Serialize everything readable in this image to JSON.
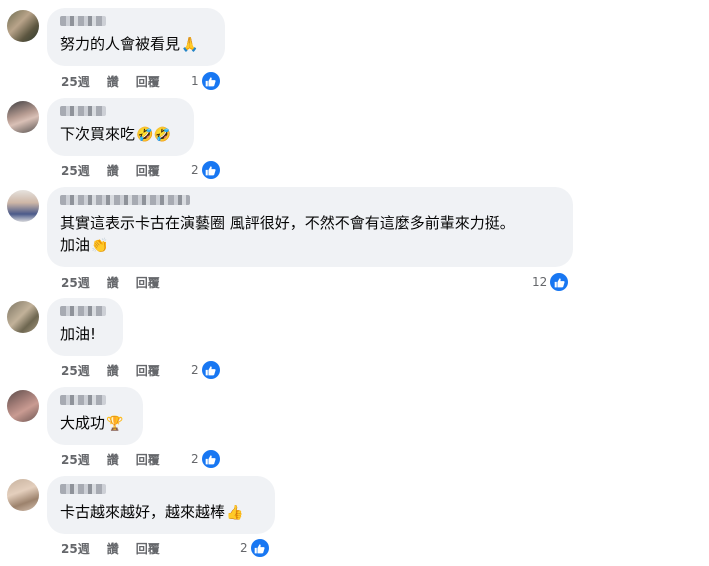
{
  "colors": {
    "bubble_bg": "#f0f2f5",
    "meta_text": "#65676b",
    "like_blue": "#1877f2"
  },
  "actions": {
    "like": "讚",
    "reply": "回覆"
  },
  "comments": [
    {
      "time": "25週",
      "lines": [
        "努力的人會被看見"
      ],
      "emoji": "🙏",
      "emoji_name": "praying-hands-icon",
      "likes": "1"
    },
    {
      "time": "25週",
      "lines": [
        "下次買來吃"
      ],
      "emoji": "🤣🤣",
      "emoji_name": "rolling-laughing-icon",
      "likes": "2"
    },
    {
      "time": "25週",
      "lines": [
        "其實這表示卡古在演藝圈 風評很好，不然不會有這麼多前輩來力挺。",
        "加油"
      ],
      "emoji": "👏",
      "emoji_name": "clapping-hands-icon",
      "likes": "12"
    },
    {
      "time": "25週",
      "lines": [
        "加油!"
      ],
      "emoji": "",
      "emoji_name": "",
      "likes": "2"
    },
    {
      "time": "25週",
      "lines": [
        "大成功"
      ],
      "emoji": "🏆",
      "emoji_name": "trophy-icon",
      "likes": "2"
    },
    {
      "time": "25週",
      "lines": [
        "卡古越來越好，越來越棒"
      ],
      "emoji": "👍",
      "emoji_name": "thumbs-up-icon",
      "likes": "2"
    }
  ]
}
